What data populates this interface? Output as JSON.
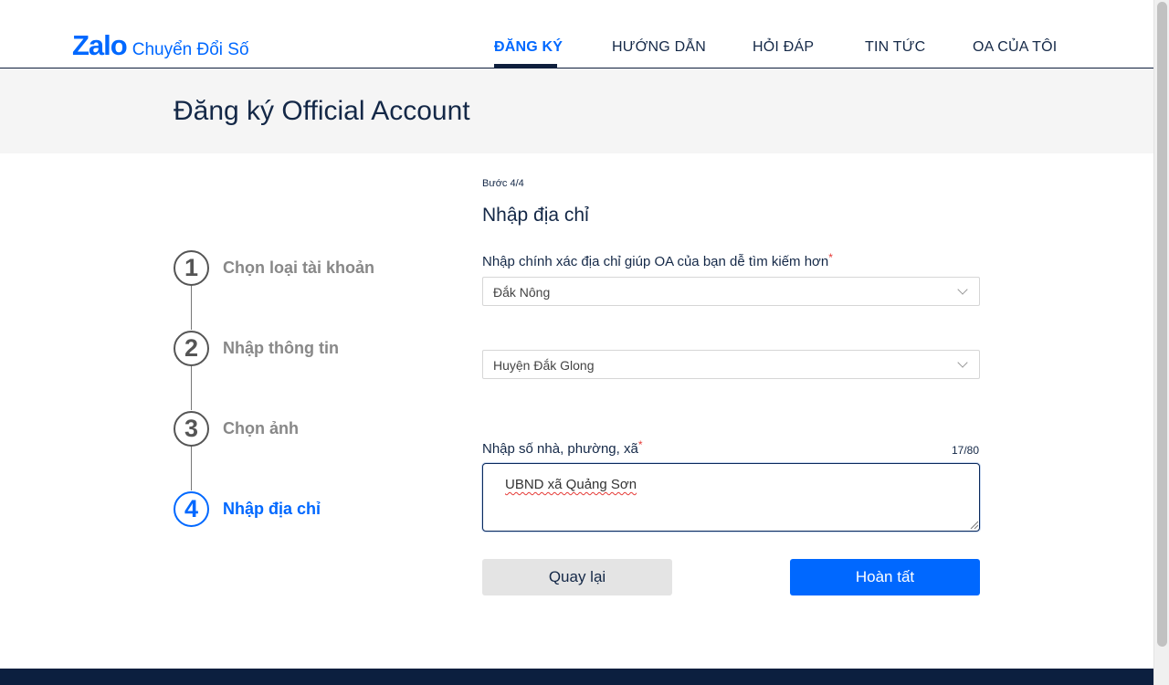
{
  "header": {
    "logo_main": "Zalo",
    "logo_sub": "Chuyển Đổi Số",
    "nav": [
      {
        "label": "ĐĂNG KÝ",
        "active": true
      },
      {
        "label": "HƯỚNG DẪN",
        "active": false
      },
      {
        "label": "HỎI ĐÁP",
        "active": false
      },
      {
        "label": "TIN TỨC",
        "active": false
      },
      {
        "label": "OA CỦA TÔI",
        "active": false
      }
    ]
  },
  "page_title": "Đăng ký Official Account",
  "stepper": [
    {
      "number": "1",
      "label": "Chọn loại tài khoản",
      "active": false
    },
    {
      "number": "2",
      "label": "Nhập thông tin",
      "active": false
    },
    {
      "number": "3",
      "label": "Chọn ảnh",
      "active": false
    },
    {
      "number": "4",
      "label": "Nhập địa chỉ",
      "active": true
    }
  ],
  "form": {
    "step_indicator": "Bước 4/4",
    "section_title": "Nhập địa chỉ",
    "address_label": "Nhập chính xác địa chỉ giúp OA của bạn dễ tìm kiếm hơn",
    "required_mark": "*",
    "province_value": "Đắk Nông",
    "district_value": "Huyện Đắk Glong",
    "street_label": "Nhập số nhà, phường, xã",
    "street_counter": "17/80",
    "street_value": "UBND xã Quảng Sơn",
    "back_label": "Quay lại",
    "done_label": "Hoàn tất"
  },
  "colors": {
    "accent": "#0068ff",
    "navy": "#142847",
    "footer": "#0c1f3f",
    "required": "#e53935"
  }
}
